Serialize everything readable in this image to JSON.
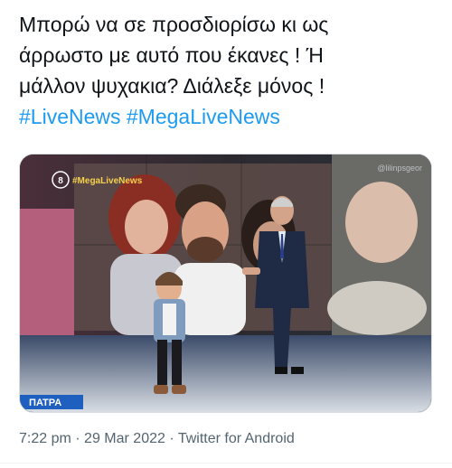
{
  "tweet": {
    "text_lines": [
      "Μπορώ να σε προσδιορίσω κι ως",
      "άρρωστο με αυτό που έκανες ! Ή",
      "μάλλον ψυχακια? Διάλεξε μόνος !"
    ],
    "hashtags": [
      "#LiveNews",
      "#MegaLiveNews"
    ]
  },
  "media": {
    "channel_logo": "#MegaLiveNews",
    "channel_number": "8",
    "watermark": "@lilinpsgeor",
    "lower_label": "ΠΑΤΡΑ"
  },
  "meta": {
    "time": "7:22 pm",
    "separator": "·",
    "date": "29 Mar 2022",
    "source": "Twitter for Android"
  }
}
